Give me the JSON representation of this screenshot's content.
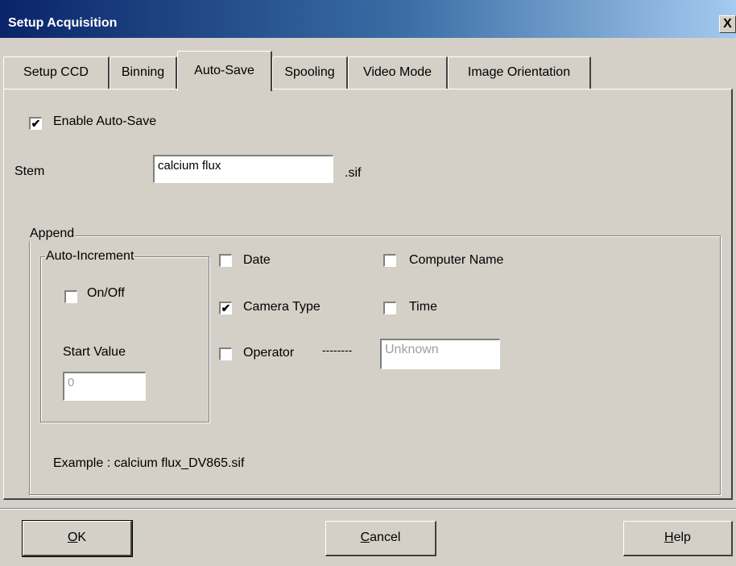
{
  "window": {
    "title": "Setup Acquisition",
    "close_label": "X"
  },
  "tabs": [
    {
      "label": "Setup CCD"
    },
    {
      "label": "Binning"
    },
    {
      "label": "Auto-Save"
    },
    {
      "label": "Spooling"
    },
    {
      "label": "Video Mode"
    },
    {
      "label": "Image Orientation"
    }
  ],
  "active_tab": "Auto-Save",
  "autosave": {
    "enable_label": "Enable Auto-Save",
    "enable_checked": true,
    "stem_label": "Stem",
    "stem_value": "calcium flux",
    "stem_suffix": ".sif"
  },
  "append": {
    "group_label": "Append",
    "auto_increment": {
      "group_label": "Auto-Increment",
      "onoff_label": "On/Off",
      "onoff_checked": false,
      "start_value_label": "Start Value",
      "start_value": "0"
    },
    "date": {
      "label": "Date",
      "checked": false
    },
    "computer_name": {
      "label": "Computer Name",
      "checked": false
    },
    "camera_type": {
      "label": "Camera Type",
      "checked": true
    },
    "time": {
      "label": "Time",
      "checked": false
    },
    "operator": {
      "label": "Operator",
      "checked": false,
      "dashes": "--------",
      "value": "Unknown"
    },
    "example": "Example : calcium flux_DV865.sif"
  },
  "buttons": {
    "ok": {
      "accel": "O",
      "rest": "K"
    },
    "cancel": {
      "accel": "C",
      "rest": "ancel"
    },
    "help": {
      "accel": "H",
      "rest": "elp"
    }
  },
  "icons": {
    "checkmark": "check-icon"
  }
}
